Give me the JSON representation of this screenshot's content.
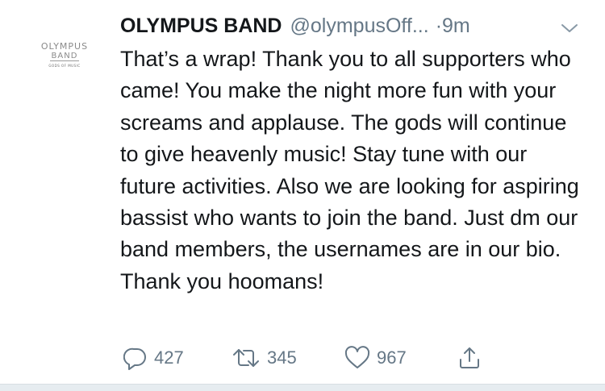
{
  "tweet": {
    "display_name": "OLYMPUS BAND",
    "handle": "@olympusOff...",
    "time": "·9m",
    "avatar": {
      "line1": "OLYMPUS",
      "line2": "BAND",
      "line3": "GODS OF MUSIC"
    },
    "text": "That’s a wrap! Thank you to all supporters who came! You make the night more fun with your screams and applause. The gods will continue to give heavenly music! Stay tune with our future activities. Also we are looking for aspiring bassist who wants to join the band. Just dm our band members, the usernames are in our bio. Thank you hoomans!",
    "replies": "427",
    "retweets": "345",
    "likes": "967"
  },
  "icons": {
    "options": "chevron-down-icon",
    "reply": "reply-icon",
    "retweet": "retweet-icon",
    "like": "heart-icon",
    "share": "share-icon"
  },
  "colors": {
    "primary_text": "#14171a",
    "secondary_text": "#657786",
    "divider": "#e6ecf0"
  }
}
